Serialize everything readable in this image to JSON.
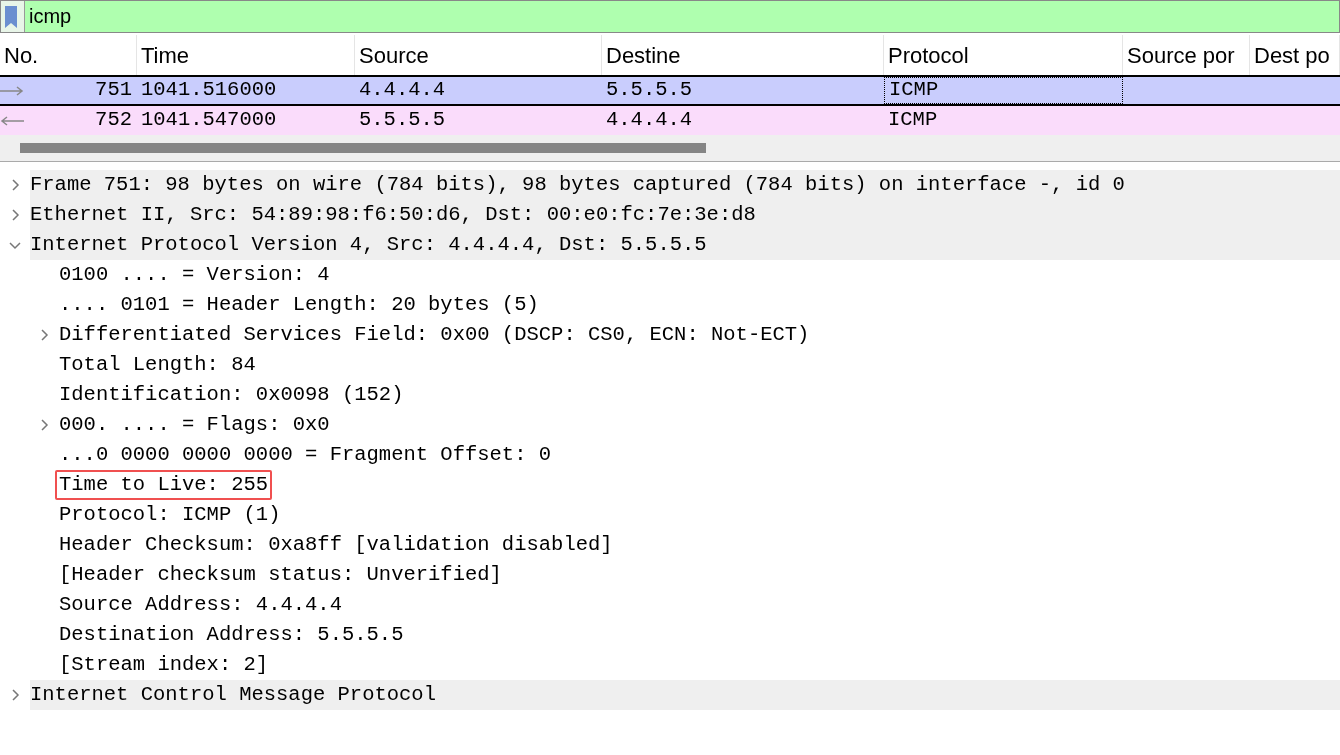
{
  "filter": {
    "value": "icmp"
  },
  "packet_list": {
    "columns": [
      "No.",
      "Time",
      "Source",
      "Destine",
      "Protocol",
      "Source por",
      "Dest po"
    ],
    "rows": [
      {
        "cells": [
          "751",
          "1041.516000",
          "4.4.4.4",
          "5.5.5.5",
          "ICMP",
          "",
          ""
        ],
        "kind": "request",
        "color": "#c9cdfd",
        "selected": true
      },
      {
        "cells": [
          "752",
          "1041.547000",
          "5.5.5.5",
          "4.4.4.4",
          "ICMP",
          "",
          ""
        ],
        "kind": "reply",
        "color": "#fadcfb",
        "selected": false
      }
    ]
  },
  "details": [
    {
      "text": "Frame 751: 98 bytes on wire (784 bits), 98 bytes captured (784 bits) on interface -, id 0",
      "expanded": false
    },
    {
      "text": "Ethernet II, Src: 54:89:98:f6:50:d6, Dst: 00:e0:fc:7e:3e:d8",
      "expanded": false
    },
    {
      "text": "Internet Protocol Version 4, Src: 4.4.4.4, Dst: 5.5.5.5",
      "expanded": true,
      "children": [
        {
          "text": "0100 .... = Version: 4",
          "highlighted": false
        },
        {
          "text": ".... 0101 = Header Length: 20 bytes (5)",
          "highlighted": false
        },
        {
          "text": "Differentiated Services Field: 0x00 (DSCP: CS0, ECN: Not-ECT)",
          "expanded": false,
          "highlighted": false
        },
        {
          "text": "Total Length: 84",
          "highlighted": false
        },
        {
          "text": "Identification: 0x0098 (152)",
          "highlighted": false
        },
        {
          "text": "000. .... = Flags: 0x0",
          "expanded": false,
          "highlighted": false
        },
        {
          "text": "...0 0000 0000 0000 = Fragment Offset: 0",
          "highlighted": false
        },
        {
          "text": "Time to Live: 255",
          "highlighted": true
        },
        {
          "text": "Protocol: ICMP (1)",
          "highlighted": false
        },
        {
          "text": "Header Checksum: 0xa8ff [validation disabled]",
          "highlighted": false
        },
        {
          "text": "[Header checksum status: Unverified]",
          "highlighted": false
        },
        {
          "text": "Source Address: 4.4.4.4",
          "highlighted": false
        },
        {
          "text": "Destination Address: 5.5.5.5",
          "highlighted": false
        },
        {
          "text": "[Stream index: 2]",
          "highlighted": false
        }
      ]
    },
    {
      "text": "Internet Control Message Protocol",
      "expanded": false
    }
  ]
}
